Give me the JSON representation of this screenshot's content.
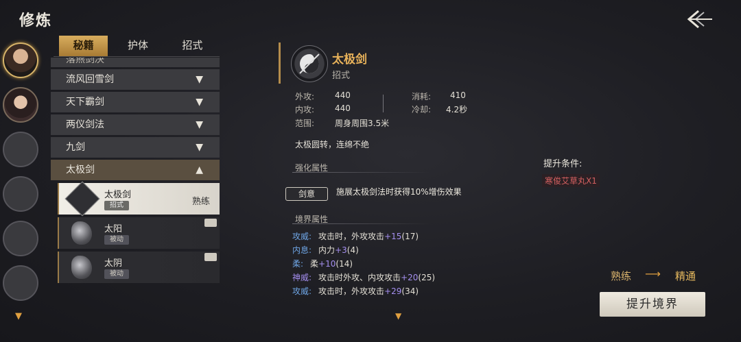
{
  "header": {
    "title": "修炼"
  },
  "tabs": [
    "秘籍",
    "护体",
    "招式"
  ],
  "sidebar": {
    "categories": [
      "落燕剑决",
      "流风回雪剑",
      "天下霸剑",
      "两仪剑法",
      "九剑",
      "太极剑"
    ],
    "skills": [
      {
        "name": "太极剑",
        "tag": "招式",
        "level": "熟练"
      },
      {
        "name": "太阳",
        "tag": "被动"
      },
      {
        "name": "太阴",
        "tag": "被动"
      }
    ]
  },
  "detail": {
    "name": "太极剑",
    "type": "招式",
    "stats": {
      "atk_label": "外攻:",
      "atk": "440",
      "inner_label": "内攻:",
      "inner": "440",
      "range_label": "范围:",
      "range": "周身周围3.5米",
      "cost_label": "消耗:",
      "cost": "410",
      "cd_label": "冷却:",
      "cd": "4.2秒"
    },
    "description": "太极圆转，连绵不绝",
    "enhance_title": "强化属性",
    "enhance_badge": "剑意",
    "enhance_text": "施展太极剑法时获得10%增伤效果",
    "realm_title": "境界属性",
    "realm_attrs": [
      {
        "key": "攻威:",
        "key_color": "#6fa6e6",
        "text": "攻击时，外攻攻击",
        "plus": "+15",
        "base": "(17)"
      },
      {
        "key": "内息:",
        "key_color": "#6fa6e6",
        "text": "内力",
        "plus": "+3",
        "base": "(4)"
      },
      {
        "key": "柔:",
        "key_color": "#6fa6e6",
        "text": "柔",
        "plus": "+10",
        "base": "(14)"
      },
      {
        "key": "神威:",
        "key_color": "#a58ff0",
        "text": "攻击时外攻、内攻攻击",
        "plus": "+20",
        "base": "(25)"
      },
      {
        "key": "攻威:",
        "key_color": "#6fa6e6",
        "text": "攻击时，外攻攻击",
        "plus": "+29",
        "base": "(34)"
      }
    ]
  },
  "upgrade": {
    "condition_title": "提升条件:",
    "condition_item": "寒俊艾草丸X1",
    "from": "熟练",
    "to": "精通",
    "button": "提升境界"
  }
}
